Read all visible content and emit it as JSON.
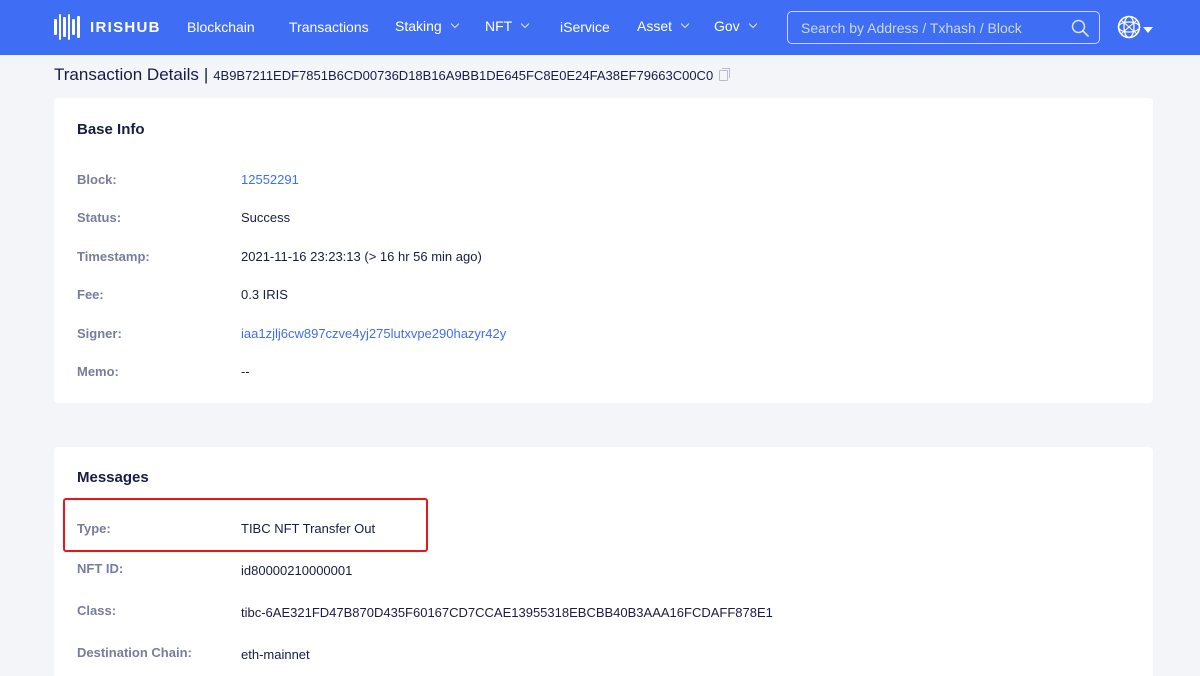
{
  "header": {
    "brand": "IRISHUB",
    "nav": [
      {
        "label": "Blockchain",
        "dropdown": false
      },
      {
        "label": "Transactions",
        "dropdown": false
      },
      {
        "label": "Staking",
        "dropdown": true
      },
      {
        "label": "NFT",
        "dropdown": true
      },
      {
        "label": "iService",
        "dropdown": false
      },
      {
        "label": "Asset",
        "dropdown": true
      },
      {
        "label": "Gov",
        "dropdown": true
      }
    ],
    "search": {
      "placeholder": "Search by Address / Txhash / Block",
      "value": ""
    },
    "icons": [
      "logo-bars-icon",
      "search-icon",
      "globe-icon",
      "caret-down-icon"
    ]
  },
  "page": {
    "title": "Transaction Details",
    "separator": "|",
    "tx_hash": "4B9B7211EDF7851B6CD00736D18B16A9BB1DE645FC8E0E24FA38EF79663C00C0"
  },
  "base_info": {
    "title": "Base Info",
    "rows": [
      {
        "label": "Block:",
        "value": "12552291"
      },
      {
        "label": "Status:",
        "value": "Success"
      },
      {
        "label": "Timestamp:",
        "value": "2021-11-16 23:23:13 (> 16 hr 56 min ago)"
      },
      {
        "label": "Fee:",
        "value": "0.3 IRIS"
      },
      {
        "label": "Signer:",
        "value": "iaa1zjlj6cw897czve4yj275lutxvpe290hazyr42y"
      },
      {
        "label": "Memo:",
        "value": "--"
      }
    ]
  },
  "messages": {
    "title": "Messages",
    "rows": [
      {
        "label": "Type:",
        "value": "TIBC NFT Transfer Out"
      },
      {
        "label": "NFT ID:",
        "value": "id80000210000001"
      },
      {
        "label": "Class:",
        "value": "tibc-6AE321FD47B870D435F60167CD7CCAE13955318EBCBB40B3AAA16FCDAFF878E1"
      },
      {
        "label": "Destination Chain:",
        "value": "eth-mainnet"
      }
    ]
  },
  "colors": {
    "nav_bg": "#3f6ef5",
    "link": "#3f6ef5",
    "label": "#777d9c",
    "text": "#171d44",
    "highlight": "#e8151b",
    "page_bg": "#f4f5f9"
  }
}
